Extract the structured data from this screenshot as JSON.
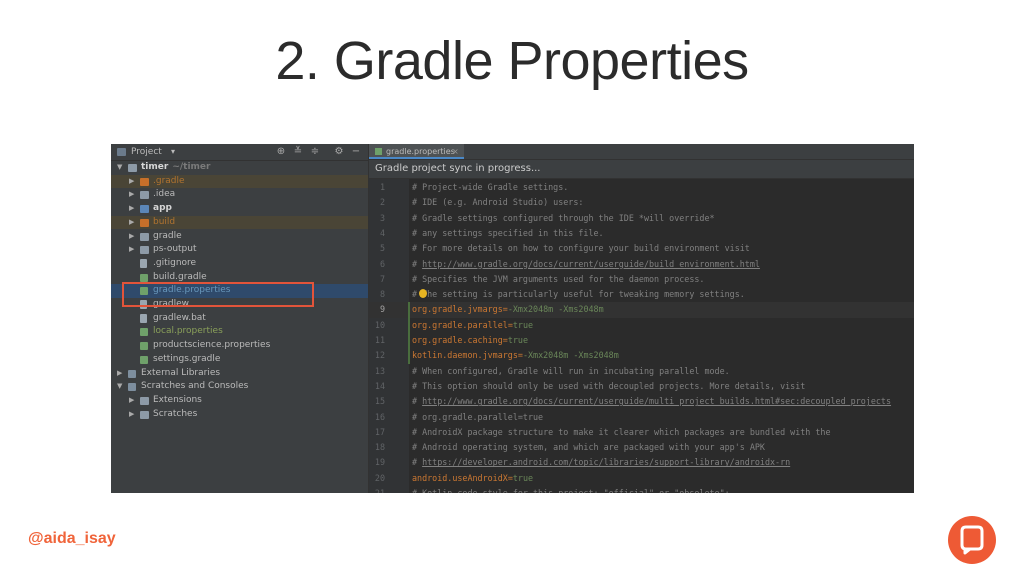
{
  "slide": {
    "title": "2. Gradle Properties",
    "handle": "@aida_isay"
  },
  "project_panel": {
    "title": "Project",
    "tree": [
      {
        "label": "timer",
        "suffix": "~/timer",
        "indent": 0,
        "arrow": "down",
        "icon": "folder",
        "style": "bold"
      },
      {
        "label": ".gradle",
        "indent": 1,
        "arrow": "right",
        "icon": "folder-orange",
        "style": "orange",
        "highlight": true
      },
      {
        "label": ".idea",
        "indent": 1,
        "arrow": "right",
        "icon": "folder",
        "style": "normal"
      },
      {
        "label": "app",
        "indent": 1,
        "arrow": "right",
        "icon": "folder-blue",
        "style": "bold"
      },
      {
        "label": "build",
        "indent": 1,
        "arrow": "right",
        "icon": "folder-orange",
        "style": "orange",
        "highlight": true
      },
      {
        "label": "gradle",
        "indent": 1,
        "arrow": "right",
        "icon": "folder",
        "style": "normal"
      },
      {
        "label": "ps-output",
        "indent": 1,
        "arrow": "right",
        "icon": "folder",
        "style": "normal"
      },
      {
        "label": ".gitignore",
        "indent": 1,
        "arrow": "",
        "icon": "file",
        "style": "normal"
      },
      {
        "label": "build.gradle",
        "indent": 1,
        "arrow": "",
        "icon": "gradle",
        "style": "normal"
      },
      {
        "label": "gradle.properties",
        "indent": 1,
        "arrow": "",
        "icon": "gradle",
        "style": "blue",
        "selected": true
      },
      {
        "label": "gradlew",
        "indent": 1,
        "arrow": "",
        "icon": "file",
        "style": "normal"
      },
      {
        "label": "gradlew.bat",
        "indent": 1,
        "arrow": "",
        "icon": "file",
        "style": "normal"
      },
      {
        "label": "local.properties",
        "indent": 1,
        "arrow": "",
        "icon": "gradle",
        "style": "green"
      },
      {
        "label": "productscience.properties",
        "indent": 1,
        "arrow": "",
        "icon": "gradle",
        "style": "normal"
      },
      {
        "label": "settings.gradle",
        "indent": 1,
        "arrow": "",
        "icon": "gradle",
        "style": "normal"
      },
      {
        "label": "External Libraries",
        "indent": 0,
        "arrow": "right",
        "icon": "lib",
        "style": "normal"
      },
      {
        "label": "Scratches and Consoles",
        "indent": 0,
        "arrow": "down",
        "icon": "lib",
        "style": "normal"
      },
      {
        "label": "Extensions",
        "indent": 1,
        "arrow": "right",
        "icon": "folder",
        "style": "normal"
      },
      {
        "label": "Scratches",
        "indent": 1,
        "arrow": "right",
        "icon": "folder",
        "style": "normal"
      }
    ]
  },
  "editor": {
    "tab_label": "gradle.properties",
    "tab_close": "×",
    "sync_message": "Gradle project sync in progress...",
    "current_line": 9,
    "lines": [
      {
        "n": 1,
        "parts": [
          {
            "t": "# Project-wide Gradle settings.",
            "c": "comment"
          }
        ]
      },
      {
        "n": 2,
        "parts": [
          {
            "t": "# IDE (e.g. Android Studio) users:",
            "c": "comment"
          }
        ]
      },
      {
        "n": 3,
        "parts": [
          {
            "t": "# Gradle settings configured through the IDE *will override*",
            "c": "comment"
          }
        ]
      },
      {
        "n": 4,
        "parts": [
          {
            "t": "# any settings specified in this file.",
            "c": "comment"
          }
        ]
      },
      {
        "n": 5,
        "parts": [
          {
            "t": "# For more details on how to configure your build environment visit",
            "c": "comment"
          }
        ]
      },
      {
        "n": 6,
        "parts": [
          {
            "t": "# ",
            "c": "comment"
          },
          {
            "t": "http://www.gradle.org/docs/current/userguide/build_environment.html",
            "c": "link"
          }
        ]
      },
      {
        "n": 7,
        "parts": [
          {
            "t": "# Specifies the JVM arguments used for the daemon process.",
            "c": "comment"
          }
        ]
      },
      {
        "n": 8,
        "parts": [
          {
            "t": "#  The setting is particularly useful for tweaking memory settings.",
            "c": "comment"
          }
        ],
        "bulb": true
      },
      {
        "n": 9,
        "parts": [
          {
            "t": "org.gradle.jvmargs",
            "c": "key"
          },
          {
            "t": "=",
            "c": "eq"
          },
          {
            "t": "-Xmx2048m -Xms2048m",
            "c": "val"
          }
        ],
        "changed": true
      },
      {
        "n": 10,
        "parts": [
          {
            "t": "org.gradle.parallel",
            "c": "key"
          },
          {
            "t": "=",
            "c": "eq"
          },
          {
            "t": "true",
            "c": "val"
          }
        ],
        "changed": true
      },
      {
        "n": 11,
        "parts": [
          {
            "t": "org.gradle.caching",
            "c": "key"
          },
          {
            "t": "=",
            "c": "eq"
          },
          {
            "t": "true",
            "c": "val"
          }
        ],
        "changed": true
      },
      {
        "n": 12,
        "parts": [
          {
            "t": "kotlin.daemon.jvmargs",
            "c": "key"
          },
          {
            "t": "=",
            "c": "eq"
          },
          {
            "t": "-Xmx2048m -Xms2048m",
            "c": "val"
          }
        ],
        "changed": true
      },
      {
        "n": 13,
        "parts": [
          {
            "t": "# When configured, Gradle will run in incubating parallel mode.",
            "c": "comment"
          }
        ]
      },
      {
        "n": 14,
        "parts": [
          {
            "t": "# This option should only be used with decoupled projects. More details, visit",
            "c": "comment"
          }
        ]
      },
      {
        "n": 15,
        "parts": [
          {
            "t": "# ",
            "c": "comment"
          },
          {
            "t": "http://www.gradle.org/docs/current/userguide/multi_project_builds.html#sec:decoupled_projects",
            "c": "link"
          }
        ]
      },
      {
        "n": 16,
        "parts": [
          {
            "t": "# org.gradle.parallel=true",
            "c": "comment"
          }
        ]
      },
      {
        "n": 17,
        "parts": [
          {
            "t": "# AndroidX package structure to make it clearer which packages are bundled with the",
            "c": "comment"
          }
        ]
      },
      {
        "n": 18,
        "parts": [
          {
            "t": "# Android operating system, and which are packaged with your app's APK",
            "c": "comment"
          }
        ]
      },
      {
        "n": 19,
        "parts": [
          {
            "t": "# ",
            "c": "comment"
          },
          {
            "t": "https://developer.android.com/topic/libraries/support-library/androidx-rn",
            "c": "link"
          }
        ]
      },
      {
        "n": 20,
        "parts": [
          {
            "t": "android.useAndroidX",
            "c": "key"
          },
          {
            "t": "=",
            "c": "eq"
          },
          {
            "t": "true",
            "c": "val"
          }
        ]
      },
      {
        "n": 21,
        "parts": [
          {
            "t": "# Kotlin code style for this project: \"official\" or \"obsolete\":",
            "c": "comment"
          }
        ]
      }
    ]
  }
}
